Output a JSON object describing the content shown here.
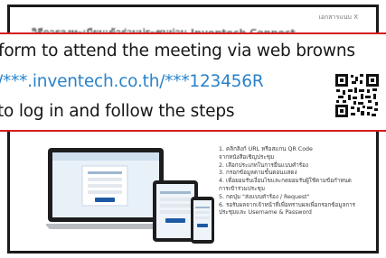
{
  "banner": {
    "line1": "form to attend the meeting via web browns",
    "line2": "/***.inventech.co.th/***123456R",
    "line3": "to log in and follow the steps"
  },
  "top": {
    "label": "เอกสารแนบ X",
    "heading_blur": "วิธีการลงทะเบียนเข้าร่วมประชุมผ่าน Inventech Connect"
  },
  "steps": [
    "1. คลิกลิงก์ URL หรือสแกน QR Code",
    "    จากหนังสือเชิญประชุม",
    "2. เลือกประเภทในการยื่นแบบคำร้อง",
    "3. กรอกข้อมูลตามขั้นตอนแสดง",
    "4. เพื่อยอมรับเงื่อนไขและกดยอมรับผู้ใช้ตามข้อกำหนด",
    "    การเข้าร่วมประชุม",
    "5. กดปุ่ม \"ส่งแบบคำร้อง / Request\"",
    "6. รอรับผลจากเจ้าหน้าที่เพื่อทราบผลเพื่อกรอกข้อมูลการ",
    "    ประชุมและ Username & Password"
  ],
  "colors": {
    "banner_border": "#d51c1c",
    "url_blue": "#2a82c9",
    "card_border": "#1a1a1a"
  },
  "icons": [
    "qr-code-icon"
  ]
}
